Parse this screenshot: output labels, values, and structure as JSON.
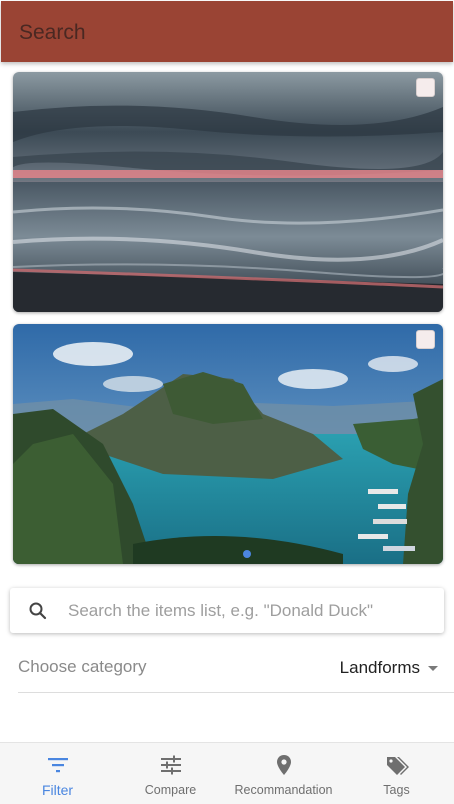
{
  "header": {
    "title": "Search"
  },
  "cards": [
    {
      "name": "card-sunset-sea"
    },
    {
      "name": "card-lagoon-islands"
    }
  ],
  "search": {
    "placeholder": "Search the items list, e.g. \"Donald Duck\"",
    "value": ""
  },
  "category": {
    "label": "Choose category",
    "selected": "Landforms"
  },
  "bottom_nav": {
    "active": "Filter",
    "items": [
      {
        "label": "Filter",
        "icon": "filter-icon"
      },
      {
        "label": "Compare",
        "icon": "tune-sliders-icon"
      },
      {
        "label": "Recommandation",
        "icon": "location-pin-icon"
      },
      {
        "label": "Tags",
        "icon": "tags-icon"
      }
    ]
  },
  "colors": {
    "accent": "#9a4434",
    "active_nav": "#4a86e0",
    "inactive_nav": "#6f6f6f"
  }
}
